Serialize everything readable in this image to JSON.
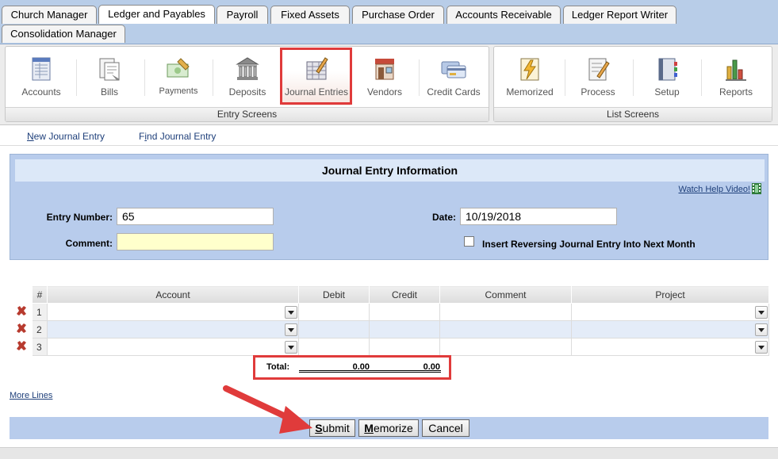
{
  "tabs_row1": [
    {
      "label": "Church Manager"
    },
    {
      "label": "Ledger and Payables"
    },
    {
      "label": "Payroll"
    },
    {
      "label": "Fixed Assets"
    },
    {
      "label": "Purchase Order"
    },
    {
      "label": "Accounts Receivable"
    },
    {
      "label": "Ledger Report Writer"
    }
  ],
  "tabs_row2": [
    {
      "label": "Consolidation Manager"
    }
  ],
  "entry_screens": {
    "title": "Entry Screens",
    "items": [
      {
        "label": "Accounts",
        "icon": "accounts-icon"
      },
      {
        "label": "Bills",
        "icon": "bills-icon"
      },
      {
        "label": "Payments",
        "icon": "payments-icon"
      },
      {
        "label": "Deposits",
        "icon": "deposits-icon"
      },
      {
        "label": "Journal Entries",
        "icon": "journal-entries-icon"
      },
      {
        "label": "Vendors",
        "icon": "vendors-icon"
      },
      {
        "label": "Credit Cards",
        "icon": "credit-cards-icon"
      }
    ]
  },
  "list_screens": {
    "title": "List Screens",
    "items": [
      {
        "label": "Memorized",
        "icon": "memorized-icon"
      },
      {
        "label": "Process",
        "icon": "process-icon"
      },
      {
        "label": "Setup",
        "icon": "setup-icon"
      },
      {
        "label": "Reports",
        "icon": "reports-icon"
      }
    ]
  },
  "subnav": {
    "new_first": "N",
    "new_rest": "ew Journal Entry",
    "find_pre": "F",
    "find_first": "i",
    "find_rest": "nd Journal Entry"
  },
  "form": {
    "title": "Journal Entry Information",
    "help_link": "Watch Help Video!",
    "entry_number_label": "Entry Number:",
    "entry_number_value": "65",
    "comment_label": "Comment:",
    "comment_value": "",
    "date_label": "Date:",
    "date_value": "10/19/2018",
    "reversing_label": "Insert Reversing Journal Entry Into Next Month"
  },
  "grid": {
    "columns": [
      "#",
      "Account",
      "Debit",
      "Credit",
      "Comment",
      "Project"
    ],
    "rows": [
      {
        "num": "1"
      },
      {
        "num": "2"
      },
      {
        "num": "3"
      }
    ],
    "total_label": "Total:",
    "total_debit": "0.00",
    "total_credit": "0.00"
  },
  "more_lines": "More Lines",
  "buttons": {
    "submit_first": "S",
    "submit_rest": "ubmit",
    "memorize_first": "M",
    "memorize_rest": "emorize",
    "cancel": "Cancel"
  },
  "colors": {
    "highlight_red": "#e03b3b",
    "panel_blue": "#b8ccec",
    "link_blue": "#1e3f7a"
  }
}
